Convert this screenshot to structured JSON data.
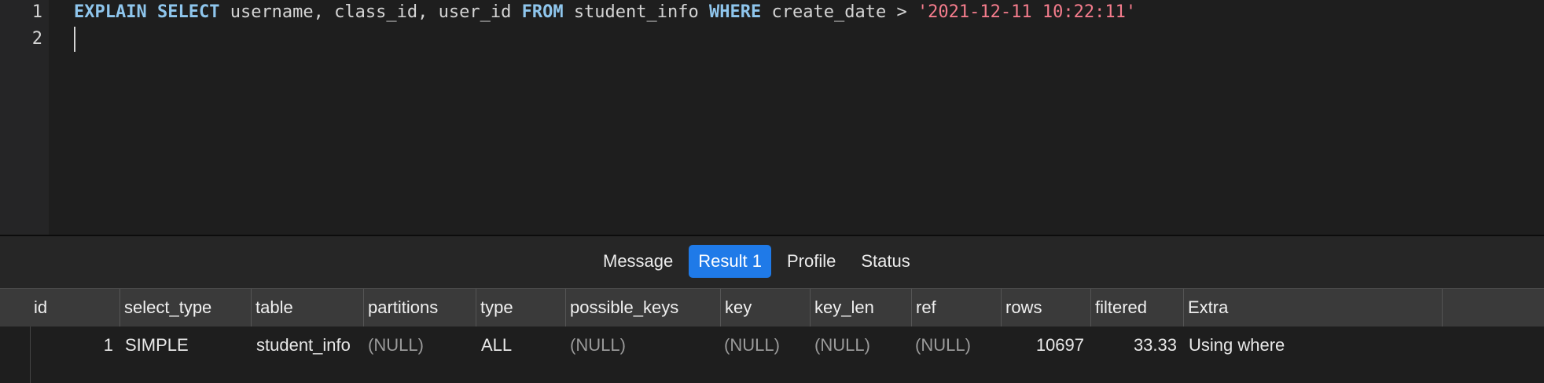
{
  "editor": {
    "line_numbers": [
      "1",
      "2"
    ],
    "line1": {
      "kw_explain": "EXPLAIN",
      "kw_select": "SELECT",
      "cols": "username, class_id, user_id",
      "kw_from": "FROM",
      "table": "student_info",
      "kw_where": "WHERE",
      "cond": "create_date >",
      "literal": "'2021-12-11 10:22:11'"
    }
  },
  "tabs": [
    {
      "label": "Message",
      "active": false
    },
    {
      "label": "Result 1",
      "active": true
    },
    {
      "label": "Profile",
      "active": false
    },
    {
      "label": "Status",
      "active": false
    }
  ],
  "grid": {
    "headers": [
      "id",
      "select_type",
      "table",
      "partitions",
      "type",
      "possible_keys",
      "key",
      "key_len",
      "ref",
      "rows",
      "filtered",
      "Extra"
    ],
    "rows": [
      [
        "1",
        "SIMPLE",
        "student_info",
        "(NULL)",
        "ALL",
        "(NULL)",
        "(NULL)",
        "(NULL)",
        "(NULL)",
        "10697",
        "33.33",
        "Using where"
      ]
    ]
  },
  "colors": {
    "keyword": "#8fc6ed",
    "string": "#f47c8c",
    "active_tab": "#1f7ae8"
  }
}
